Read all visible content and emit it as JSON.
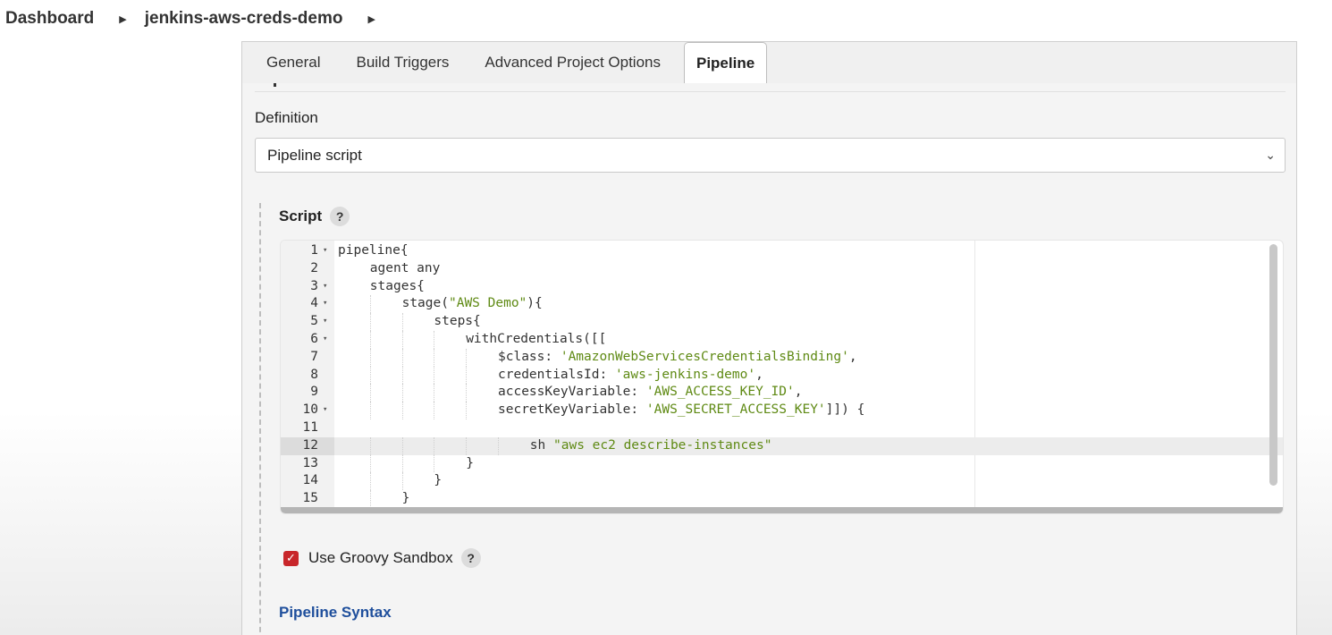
{
  "breadcrumb": {
    "items": [
      "Dashboard",
      "jenkins-aws-creds-demo"
    ]
  },
  "tabs": [
    {
      "label": "General",
      "active": false
    },
    {
      "label": "Build Triggers",
      "active": false
    },
    {
      "label": "Advanced Project Options",
      "active": false
    },
    {
      "label": "Pipeline",
      "active": true
    }
  ],
  "pipeline": {
    "definition_label": "Definition",
    "definition_value": "Pipeline script",
    "script_label": "Script",
    "help_glyph": "?",
    "sandbox_label": "Use Groovy Sandbox",
    "sandbox_checked": true,
    "syntax_link": "Pipeline Syntax"
  },
  "editor": {
    "highlighted_line": 12,
    "lines": [
      {
        "n": "1",
        "fold": true,
        "indent": 0,
        "parts": [
          [
            "kw",
            "pipeline{"
          ]
        ]
      },
      {
        "n": "2",
        "fold": false,
        "indent": 1,
        "parts": [
          [
            "kw",
            "agent any"
          ]
        ]
      },
      {
        "n": "3",
        "fold": true,
        "indent": 1,
        "parts": [
          [
            "kw",
            "stages{"
          ]
        ]
      },
      {
        "n": "4",
        "fold": true,
        "indent": 2,
        "parts": [
          [
            "kw",
            "stage("
          ],
          [
            "str",
            "\"AWS Demo\""
          ],
          [
            "kw",
            "){"
          ]
        ]
      },
      {
        "n": "5",
        "fold": true,
        "indent": 3,
        "parts": [
          [
            "kw",
            "steps{"
          ]
        ]
      },
      {
        "n": "6",
        "fold": true,
        "indent": 4,
        "parts": [
          [
            "kw",
            "withCredentials([["
          ]
        ]
      },
      {
        "n": "7",
        "fold": false,
        "indent": 5,
        "parts": [
          [
            "kw",
            "$class: "
          ],
          [
            "str",
            "'AmazonWebServicesCredentialsBinding'"
          ],
          [
            "kw",
            ","
          ]
        ]
      },
      {
        "n": "8",
        "fold": false,
        "indent": 5,
        "parts": [
          [
            "kw",
            "credentialsId: "
          ],
          [
            "str",
            "'aws-jenkins-demo'"
          ],
          [
            "kw",
            ","
          ]
        ]
      },
      {
        "n": "9",
        "fold": false,
        "indent": 5,
        "parts": [
          [
            "kw",
            "accessKeyVariable: "
          ],
          [
            "str",
            "'AWS_ACCESS_KEY_ID'"
          ],
          [
            "kw",
            ","
          ]
        ]
      },
      {
        "n": "10",
        "fold": true,
        "indent": 5,
        "parts": [
          [
            "kw",
            "secretKeyVariable: "
          ],
          [
            "str",
            "'AWS_SECRET_ACCESS_KEY'"
          ],
          [
            "kw",
            "]]) {"
          ]
        ]
      },
      {
        "n": "11",
        "fold": false,
        "indent": 0,
        "parts": []
      },
      {
        "n": "12",
        "fold": false,
        "indent": 6,
        "parts": [
          [
            "kw",
            "sh "
          ],
          [
            "str",
            "\"aws ec2 describe-instances\""
          ]
        ]
      },
      {
        "n": "13",
        "fold": false,
        "indent": 4,
        "parts": [
          [
            "kw",
            "}"
          ]
        ]
      },
      {
        "n": "14",
        "fold": false,
        "indent": 3,
        "parts": [
          [
            "kw",
            "}"
          ]
        ]
      },
      {
        "n": "15",
        "fold": false,
        "indent": 2,
        "parts": [
          [
            "kw",
            "}"
          ]
        ]
      }
    ]
  },
  "colors": {
    "string": "#5f8a14",
    "link": "#1f4f9c",
    "checkbox": "#c8262a"
  }
}
